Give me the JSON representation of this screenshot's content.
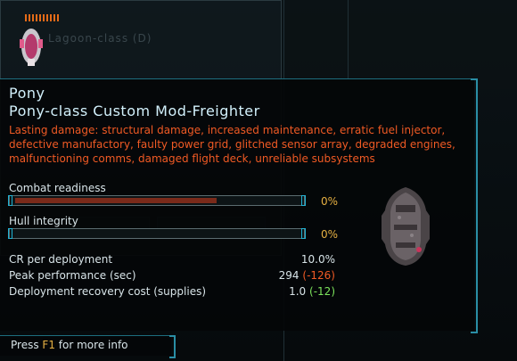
{
  "background": {
    "faint_label": "Lagoon-class (D)"
  },
  "tooltip": {
    "ship_name": "Pony",
    "ship_class": "Pony-class Custom Mod-Freighter",
    "lasting_damage": "Lasting damage: structural damage, increased maintenance, erratic fuel injector, defective manufactory, faulty power grid, glitched sensor array, degraded engines, malfunctioning comms, damaged flight deck, unreliable subsystems",
    "combat_readiness": {
      "label": "Combat readiness",
      "value_text": "0%",
      "bar_fraction": 0.71
    },
    "hull_integrity": {
      "label": "Hull integrity",
      "value_text": "0%",
      "bar_fraction": 0.0
    },
    "stats": [
      {
        "label": "CR per deployment",
        "value": "10.0%",
        "delta": ""
      },
      {
        "label": "Peak performance (sec)",
        "value": "294",
        "delta": "(-126)"
      },
      {
        "label": "Deployment recovery cost (supplies)",
        "value": "1.0",
        "delta": "(-12)"
      }
    ]
  },
  "footer": {
    "press_prefix": "Press",
    "press_key": "F1",
    "press_suffix": "for more info"
  },
  "colors": {
    "accent": "#2a8ea5",
    "damage_text": "#f05a24",
    "highlight": "#e6b042",
    "positive": "#7ce35c",
    "cr_bar_fill": "#7a2a1a"
  }
}
